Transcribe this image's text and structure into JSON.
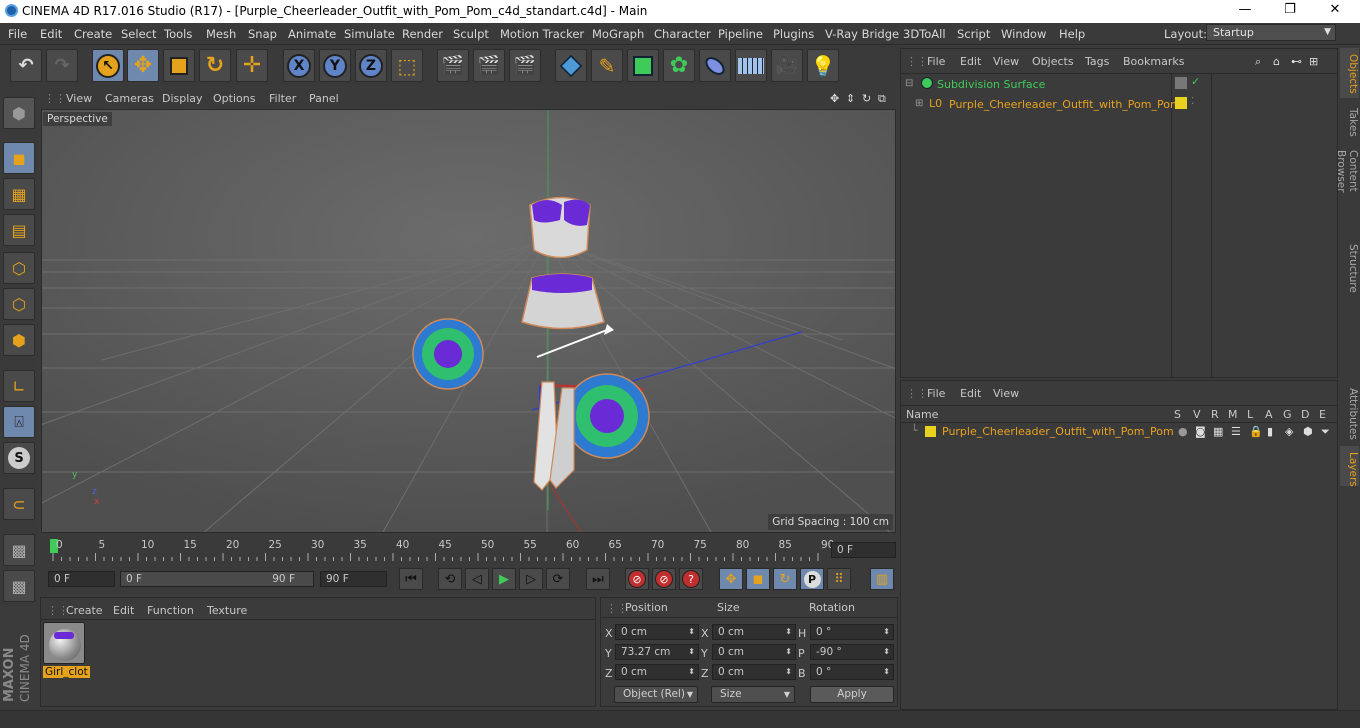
{
  "window": {
    "title": "CINEMA 4D R17.016 Studio (R17) - [Purple_Cheerleader_Outfit_with_Pom_Pom_c4d_standart.c4d] - Main",
    "minimize": "—",
    "maximize": "❐",
    "close": "✕"
  },
  "menubar": {
    "items": [
      "File",
      "Edit",
      "Create",
      "Select",
      "Tools",
      "Mesh",
      "Snap",
      "Animate",
      "Simulate",
      "Render",
      "Sculpt",
      "Motion Tracker",
      "MoGraph",
      "Character",
      "Pipeline",
      "Plugins",
      "V-Ray Bridge",
      "3DToAll",
      "Script",
      "Window",
      "Help"
    ],
    "layout_label": "Layout:",
    "layout_value": "Startup"
  },
  "toolbar": {
    "axis_x": "X",
    "axis_y": "Y",
    "axis_z": "Z"
  },
  "viewport": {
    "menu": [
      "View",
      "Cameras",
      "Display",
      "Options",
      "Filter",
      "Panel"
    ],
    "camera": "Perspective",
    "grid_spacing": "Grid Spacing : 100 cm",
    "axis_x": "x",
    "axis_y": "y",
    "axis_z": "z"
  },
  "timeline": {
    "ticks": [
      "0",
      "5",
      "10",
      "15",
      "20",
      "25",
      "30",
      "35",
      "40",
      "45",
      "50",
      "55",
      "60",
      "65",
      "70",
      "75",
      "80",
      "85",
      "90"
    ],
    "current_frame": "0 F"
  },
  "transport": {
    "start": "0 F",
    "slider_start": "0 F",
    "slider_end": "90 F",
    "end": "90 F"
  },
  "material_panel": {
    "menu": [
      "Create",
      "Edit",
      "Function",
      "Texture"
    ],
    "material_name": "Girl_clot"
  },
  "coord_panel": {
    "headers": [
      "Position",
      "Size",
      "Rotation"
    ],
    "rows": [
      {
        "axis": "X",
        "pos": "0 cm",
        "size_axis": "X",
        "size": "0 cm",
        "rot_axis": "H",
        "rot": "0 °"
      },
      {
        "axis": "Y",
        "pos": "73.27 cm",
        "size_axis": "Y",
        "size": "0 cm",
        "rot_axis": "P",
        "rot": "-90 °"
      },
      {
        "axis": "Z",
        "pos": "0 cm",
        "size_axis": "Z",
        "size": "0 cm",
        "rot_axis": "B",
        "rot": "0 °"
      }
    ],
    "mode_dropdown": "Object (Rel)",
    "size_dropdown": "Size",
    "apply": "Apply"
  },
  "object_panel": {
    "menu": [
      "File",
      "Edit",
      "View",
      "Objects",
      "Tags",
      "Bookmarks"
    ],
    "items": [
      {
        "name": "Subdivision Surface"
      },
      {
        "name": "Purple_Cheerleader_Outfit_with_Pom_Pom"
      }
    ]
  },
  "layer_panel": {
    "menu": [
      "File",
      "Edit",
      "View"
    ],
    "columns": [
      "Name",
      "S",
      "V",
      "R",
      "M",
      "L",
      "A",
      "G",
      "D",
      "E"
    ],
    "rows": [
      {
        "name": "Purple_Cheerleader_Outfit_with_Pom_Pom"
      }
    ]
  },
  "right_tabs": [
    "Objects",
    "Takes",
    "Content Browser",
    "Structure",
    "Attributes",
    "Layers"
  ],
  "branding": {
    "maxon": "MAXON",
    "product": "CINEMA 4D"
  },
  "colors": {
    "accent": "#e5a21d",
    "selected": "#6f88ad",
    "object_name": "#e8a21f",
    "layer_yellow": "#e8d11f"
  }
}
